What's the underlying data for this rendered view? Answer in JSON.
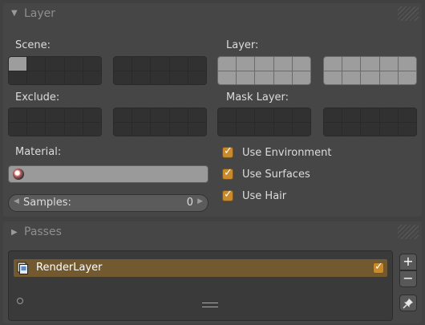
{
  "layer_panel": {
    "title": "Layer",
    "scene_label": "Scene:",
    "layer_label": "Layer:",
    "exclude_label": "Exclude:",
    "mask_layer_label": "Mask Layer:",
    "material_label": "Material:",
    "material_value": "",
    "samples": {
      "label": "Samples:",
      "value": "0"
    },
    "options": [
      {
        "label": "Use Environment",
        "checked": true
      },
      {
        "label": "Use Surfaces",
        "checked": true
      },
      {
        "label": "Use Hair",
        "checked": true
      }
    ]
  },
  "passes_panel": {
    "title": "Passes",
    "render_layers": [
      {
        "label": "RenderLayer",
        "enabled": true
      }
    ],
    "add_symbol": "+",
    "remove_symbol": "−",
    "pin_symbol": "📌"
  },
  "icons": {
    "panel_expanded": "triangle-down-icon",
    "panel_collapsed": "triangle-right-icon",
    "render_layer": "render-layer-icon",
    "material": "material-sphere-icon"
  },
  "colors": {
    "accent": "#c88a2c",
    "selected_row": "#735930",
    "layer_on": "#9d9d9d",
    "layer_off": "#313131"
  }
}
